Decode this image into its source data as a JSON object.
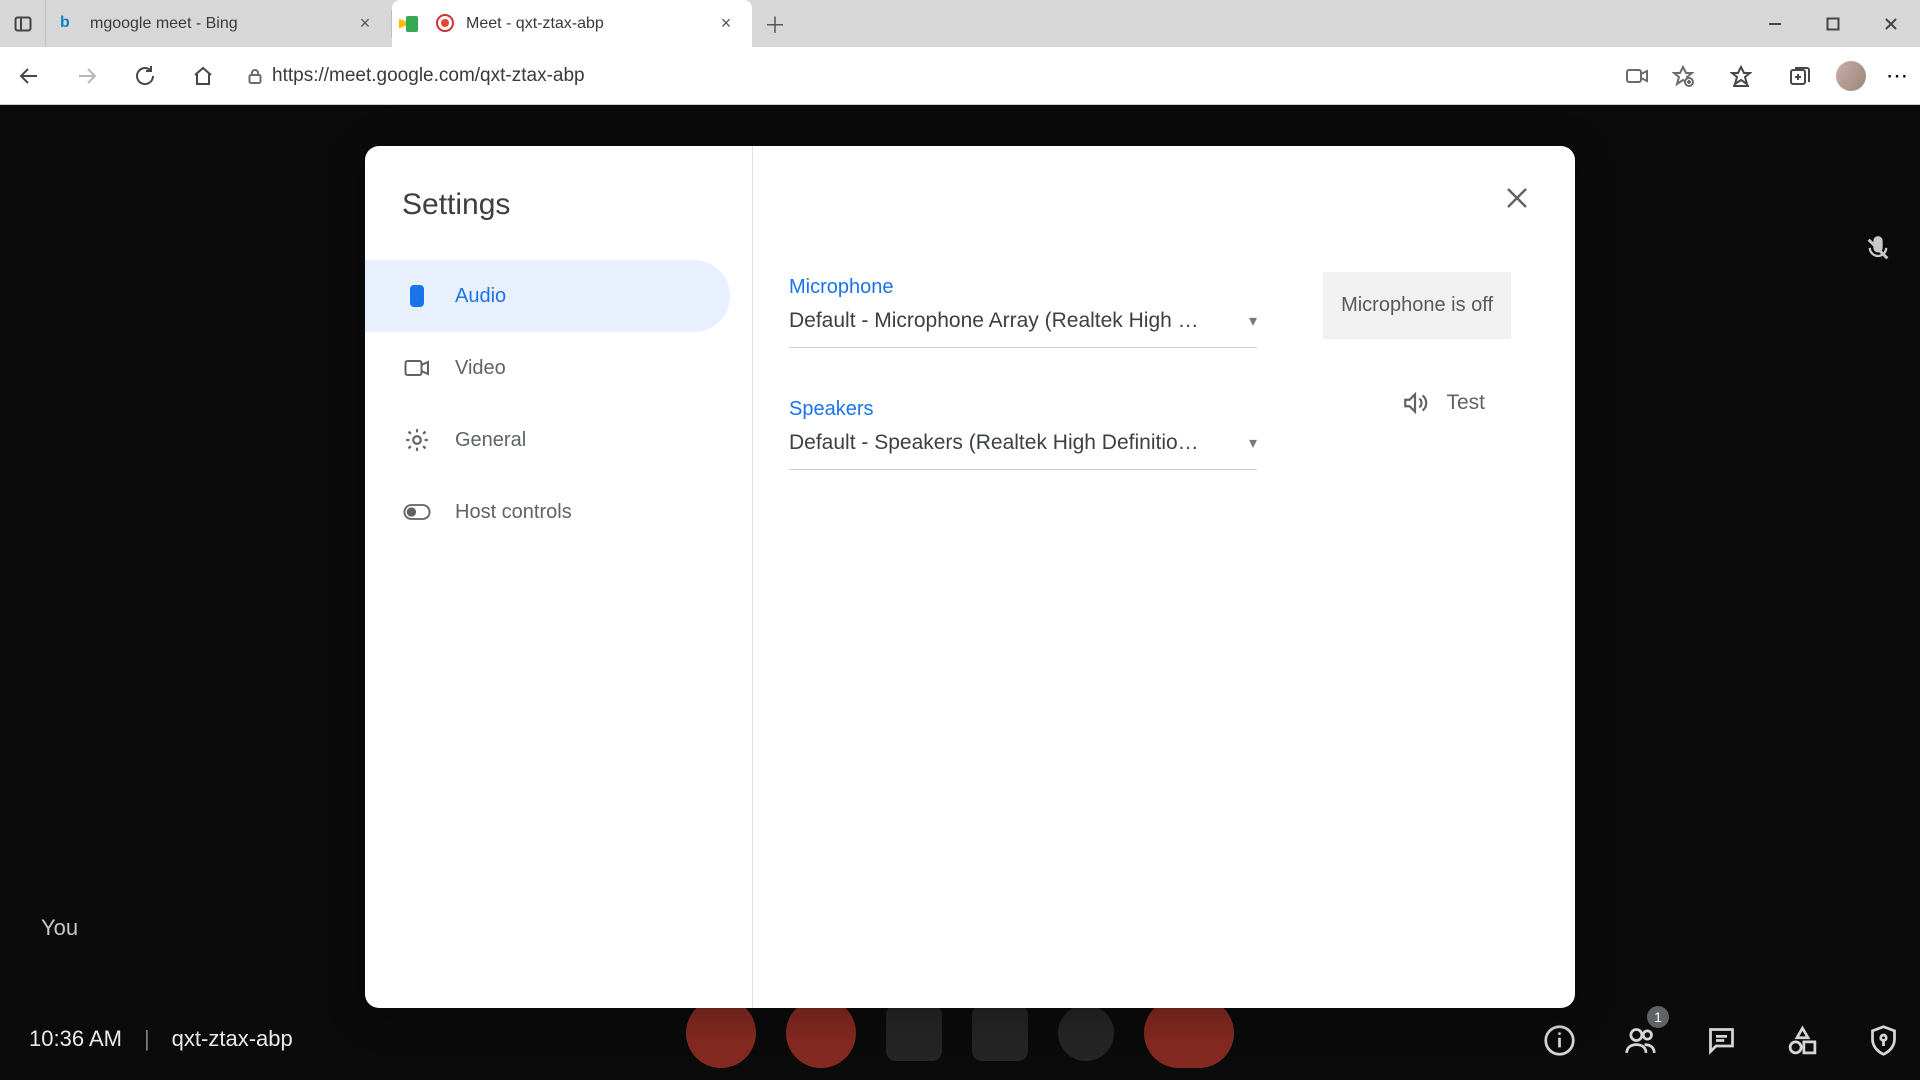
{
  "browser": {
    "tabs": [
      {
        "title": "mgoogle meet - Bing"
      },
      {
        "title": "Meet - qxt-ztax-abp"
      }
    ],
    "url": "https://meet.google.com/qxt-ztax-abp"
  },
  "meet": {
    "self_label": "You",
    "clock": "10:36 AM",
    "meeting_code": "qxt-ztax-abp",
    "participants_badge": "1"
  },
  "settings_dialog": {
    "title": "Settings",
    "nav": {
      "audio": "Audio",
      "video": "Video",
      "general": "General",
      "host": "Host controls"
    },
    "audio": {
      "mic_label": "Microphone",
      "mic_value": "Default - Microphone Array (Realtek High …",
      "mic_status": "Microphone is off",
      "spk_label": "Speakers",
      "spk_value": "Default - Speakers (Realtek High Definitio…",
      "test_label": "Test"
    }
  }
}
